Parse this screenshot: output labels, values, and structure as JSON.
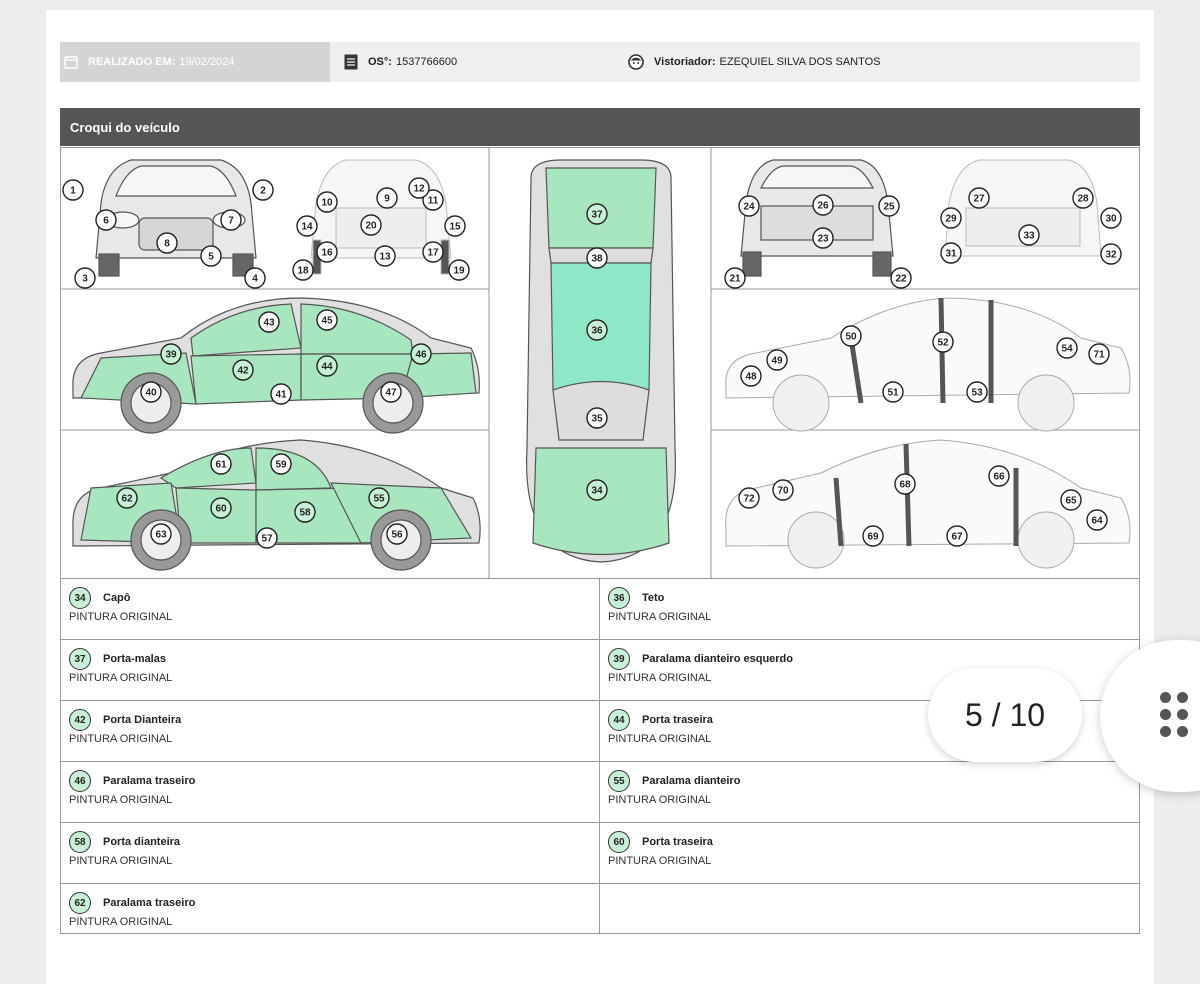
{
  "header": {
    "date_label": "REALIZADO EM:",
    "date_value": "19/02/2024",
    "os_label": "OS°:",
    "os_value": "1537766600",
    "inspector_label": "Vistoriador:",
    "inspector_value": "EZEQUIEL SILVA DOS SANTOS"
  },
  "section_title": "Croqui do veículo",
  "diagram": {
    "marker_color": "#c8f0d6",
    "paint_color": "#a8e6bf",
    "glass_color": "#8ee8c8",
    "markers": [
      "1",
      "2",
      "3",
      "4",
      "5",
      "6",
      "7",
      "8",
      "9",
      "10",
      "11",
      "12",
      "13",
      "14",
      "15",
      "16",
      "17",
      "18",
      "19",
      "20",
      "21",
      "22",
      "23",
      "24",
      "25",
      "26",
      "27",
      "28",
      "29",
      "30",
      "31",
      "32",
      "33",
      "34",
      "35",
      "36",
      "37",
      "38",
      "39",
      "40",
      "41",
      "42",
      "43",
      "44",
      "45",
      "46",
      "47",
      "48",
      "49",
      "50",
      "51",
      "52",
      "53",
      "54",
      "55",
      "56",
      "57",
      "58",
      "59",
      "60",
      "61",
      "62",
      "63",
      "64",
      "65",
      "66",
      "67",
      "68",
      "69",
      "70",
      "71",
      "72"
    ]
  },
  "parts": [
    [
      {
        "num": "34",
        "name": "Capô",
        "status": "PINTURA ORIGINAL"
      },
      {
        "num": "36",
        "name": "Teto",
        "status": "PINTURA ORIGINAL"
      }
    ],
    [
      {
        "num": "37",
        "name": "Porta-malas",
        "status": "PINTURA ORIGINAL"
      },
      {
        "num": "39",
        "name": "Paralama dianteiro esquerdo",
        "status": "PINTURA ORIGINAL"
      }
    ],
    [
      {
        "num": "42",
        "name": "Porta Dianteira",
        "status": "PINTURA ORIGINAL"
      },
      {
        "num": "44",
        "name": "Porta traseira",
        "status": "PINTURA ORIGINAL"
      }
    ],
    [
      {
        "num": "46",
        "name": "Paralama traseiro",
        "status": "PINTURA ORIGINAL"
      },
      {
        "num": "55",
        "name": "Paralama dianteiro",
        "status": "PINTURA ORIGINAL"
      }
    ],
    [
      {
        "num": "58",
        "name": "Porta dianteira",
        "status": "PINTURA ORIGINAL"
      },
      {
        "num": "60",
        "name": "Porta traseira",
        "status": "PINTURA ORIGINAL"
      }
    ],
    [
      {
        "num": "62",
        "name": "Paralama traseiro",
        "status": "PINTURA ORIGINAL"
      }
    ]
  ],
  "pager": {
    "text": "5 / 10"
  },
  "icons": {
    "calendar": "calendar-icon",
    "document": "document-icon",
    "inspector": "inspector-icon",
    "menu": "grid-dots-icon"
  }
}
